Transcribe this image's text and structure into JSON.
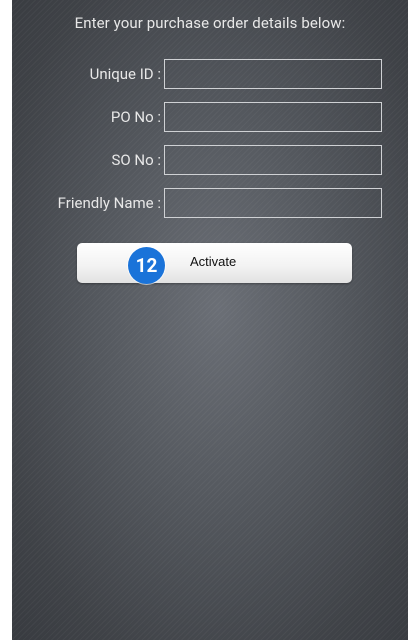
{
  "form": {
    "heading": "Enter your purchase order details below:",
    "fields": [
      {
        "label": "Unique ID :",
        "value": "",
        "placeholder": ""
      },
      {
        "label": "PO No :",
        "value": "",
        "placeholder": ""
      },
      {
        "label": "SO No :",
        "value": "",
        "placeholder": ""
      },
      {
        "label": "Friendly Name :",
        "value": "",
        "placeholder": ""
      }
    ],
    "activate_label": "Activate",
    "step_badge": "12"
  },
  "colors": {
    "background": "#55595f",
    "badge": "#1a73d9",
    "text": "#e8e8e8"
  }
}
